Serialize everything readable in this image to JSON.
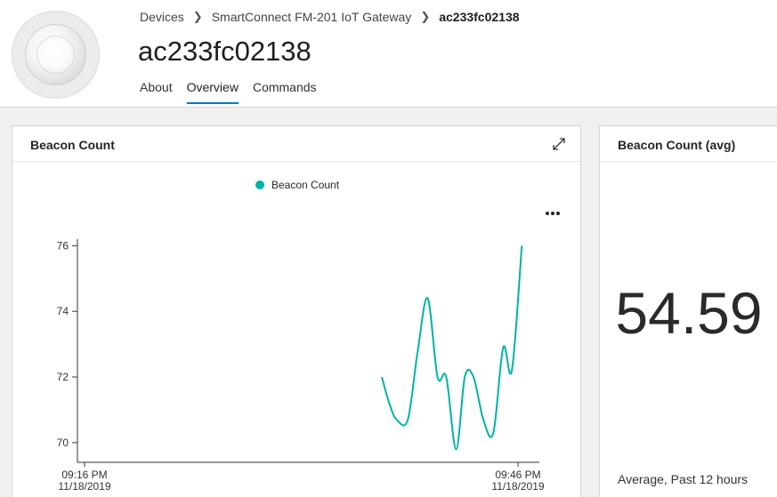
{
  "breadcrumb": {
    "items": [
      "Devices",
      "SmartConnect FM-201 IoT Gateway"
    ],
    "current": "ac233fc02138"
  },
  "device": {
    "title": "ac233fc02138",
    "image_icon": "gateway-device-image"
  },
  "tabs": [
    {
      "label": "About",
      "active": false
    },
    {
      "label": "Overview",
      "active": true
    },
    {
      "label": "Commands",
      "active": false
    }
  ],
  "chart_card": {
    "title": "Beacon Count",
    "expand_icon": "expand-icon",
    "more_icon": "more-icon"
  },
  "avg_card": {
    "title": "Beacon Count (avg)",
    "value": "54.59",
    "caption": "Average, Past 12 hours"
  },
  "colors": {
    "accent": "#0078d4",
    "series": "#00b3a4"
  },
  "chart_data": {
    "type": "line",
    "title": "Beacon Count",
    "series": [
      {
        "name": "Beacon Count",
        "points": [
          {
            "t": "09:36:00",
            "y": 72.0
          },
          {
            "t": "09:36:30",
            "y": 71.2
          },
          {
            "t": "09:37:00",
            "y": 70.7
          },
          {
            "t": "09:37:45",
            "y": 70.7
          },
          {
            "t": "09:38:25",
            "y": 72.8
          },
          {
            "t": "09:39:05",
            "y": 74.4
          },
          {
            "t": "09:39:45",
            "y": 72.0
          },
          {
            "t": "09:40:20",
            "y": 72.0
          },
          {
            "t": "09:41:00",
            "y": 69.8
          },
          {
            "t": "09:41:35",
            "y": 72.0
          },
          {
            "t": "09:42:10",
            "y": 72.0
          },
          {
            "t": "09:42:50",
            "y": 70.7
          },
          {
            "t": "09:43:30",
            "y": 70.3
          },
          {
            "t": "09:44:10",
            "y": 72.9
          },
          {
            "t": "09:44:45",
            "y": 72.2
          },
          {
            "t": "09:45:25",
            "y": 76.0
          }
        ]
      }
    ],
    "x_ticks": [
      {
        "time": "09:16 PM",
        "date": "11/18/2019"
      },
      {
        "time": "09:46 PM",
        "date": "11/18/2019"
      }
    ],
    "y_ticks": [
      70,
      72,
      74,
      76
    ],
    "xlim": [
      "09:16:00",
      "09:46:00"
    ],
    "ylim": [
      69.4,
      76.2
    ],
    "grid": false,
    "legend_position": "top-center"
  }
}
